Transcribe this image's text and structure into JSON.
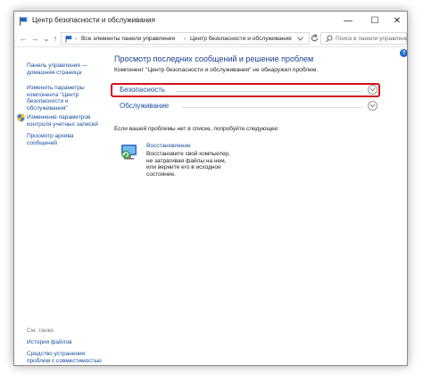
{
  "window": {
    "title": "Центр безопасности и обслуживания",
    "minimize": "—",
    "maximize": "☐",
    "close": "✕"
  },
  "address_bar": {
    "back": "←",
    "forward": "→",
    "recent": "⌄",
    "up": "↑",
    "crumbs": [
      "Все элементы панели управления",
      "Центр безопасности и обслуживания"
    ],
    "separator": "›",
    "search_placeholder": "Поиск в панели управления"
  },
  "sidebar": {
    "items": [
      "Панель управления — домашняя страница",
      "Изменить параметры компонента \"Центр безопасности и обслуживания\"",
      "Изменение параметров контроля учетных записей",
      "Просмотр архива сообщений"
    ],
    "see_also_title": "См. также",
    "see_also": [
      "История файлов",
      "Средство устранения проблем с совместимостью программ Windows"
    ]
  },
  "main": {
    "heading": "Просмотр последних сообщений и решение проблем",
    "subtext": "Компонент \"Центр безопасности и обслуживания\" не обнаружил проблем.",
    "sections": [
      "Безопасность",
      "Обслуживание"
    ],
    "notice": "Если вашей проблемы нет в списке, попробуйте следующее:",
    "recovery": {
      "link": "Восстановление",
      "description": "Восстановите свой компьютер, не затрагивая файлы на нем, или верните его в исходное состояние."
    }
  },
  "colors": {
    "link": "#1a4fa0",
    "heading": "#1a3f8f",
    "highlight": "#d4121c",
    "help": "#1c6bd0"
  }
}
